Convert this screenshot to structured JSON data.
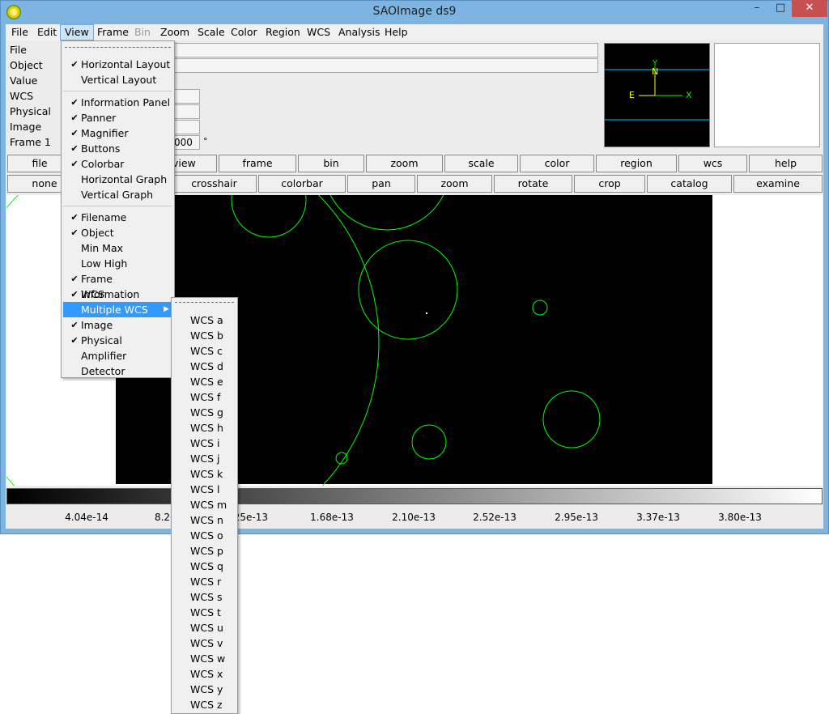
{
  "window": {
    "title": "SAOImage ds9",
    "minimize_glyph": "–",
    "maximize_glyph": "□",
    "close_glyph": "✕",
    "app_icon": "sun-icon"
  },
  "menubar": [
    "File",
    "Edit",
    "View",
    "Frame",
    "Bin",
    "Zoom",
    "Scale",
    "Color",
    "Region",
    "WCS",
    "Analysis",
    "Help"
  ],
  "info_panel": {
    "labels": [
      "File",
      "Object",
      "Value",
      "WCS",
      "Physical",
      "Image",
      "Frame 1"
    ],
    "zoom_partial": "000",
    "angle_partial": "°"
  },
  "button_bar": {
    "row1": [
      "file",
      "view",
      "frame",
      "bin",
      "zoom",
      "scale",
      "color",
      "region",
      "wcs",
      "help"
    ],
    "row2": [
      "none",
      "",
      "crosshair",
      "colorbar",
      "pan",
      "zoom",
      "rotate",
      "crop",
      "catalog",
      "examine"
    ]
  },
  "panner": {
    "axis_x": "X",
    "axis_y": "Y",
    "north": "N",
    "east": "E"
  },
  "colorbar": {
    "ticks": [
      "4.04e-14",
      "8.26e",
      ".25e-13",
      "1.68e-13",
      "2.10e-13",
      "2.52e-13",
      "2.95e-13",
      "3.37e-13",
      "3.80e-13"
    ]
  },
  "view_menu": {
    "items": [
      {
        "type": "tearoff"
      },
      {
        "label": "Horizontal Layout",
        "checked": true
      },
      {
        "label": "Vertical Layout",
        "checked": false
      },
      {
        "type": "sep"
      },
      {
        "label": "Information Panel",
        "checked": true
      },
      {
        "label": "Panner",
        "checked": true
      },
      {
        "label": "Magnifier",
        "checked": true
      },
      {
        "label": "Buttons",
        "checked": true
      },
      {
        "label": "Colorbar",
        "checked": true
      },
      {
        "label": "Horizontal Graph",
        "checked": false
      },
      {
        "label": "Vertical Graph",
        "checked": false
      },
      {
        "type": "sep"
      },
      {
        "label": "Filename",
        "checked": true
      },
      {
        "label": "Object",
        "checked": true
      },
      {
        "label": "Min Max",
        "checked": false
      },
      {
        "label": "Low High",
        "checked": false
      },
      {
        "label": "Frame Information",
        "checked": true
      },
      {
        "label": "WCS",
        "checked": true
      },
      {
        "label": "Multiple WCS",
        "checked": false,
        "highlighted": true,
        "submenu": true
      },
      {
        "label": "Image",
        "checked": true
      },
      {
        "label": "Physical",
        "checked": true
      },
      {
        "label": "Amplifier",
        "checked": false
      },
      {
        "label": "Detector",
        "checked": false
      }
    ]
  },
  "wcs_submenu": {
    "items": [
      "WCS a",
      "WCS b",
      "WCS c",
      "WCS d",
      "WCS e",
      "WCS f",
      "WCS g",
      "WCS h",
      "WCS i",
      "WCS j",
      "WCS k",
      "WCS l",
      "WCS m",
      "WCS n",
      "WCS o",
      "WCS p",
      "WCS q",
      "WCS r",
      "WCS s",
      "WCS t",
      "WCS u",
      "WCS v",
      "WCS w",
      "WCS x",
      "WCS y",
      "WCS z"
    ]
  },
  "colors": {
    "accent": "#3399ff",
    "region": "#00ff00",
    "title_bar": "#7eb4e2",
    "close_button": "#c75050"
  }
}
